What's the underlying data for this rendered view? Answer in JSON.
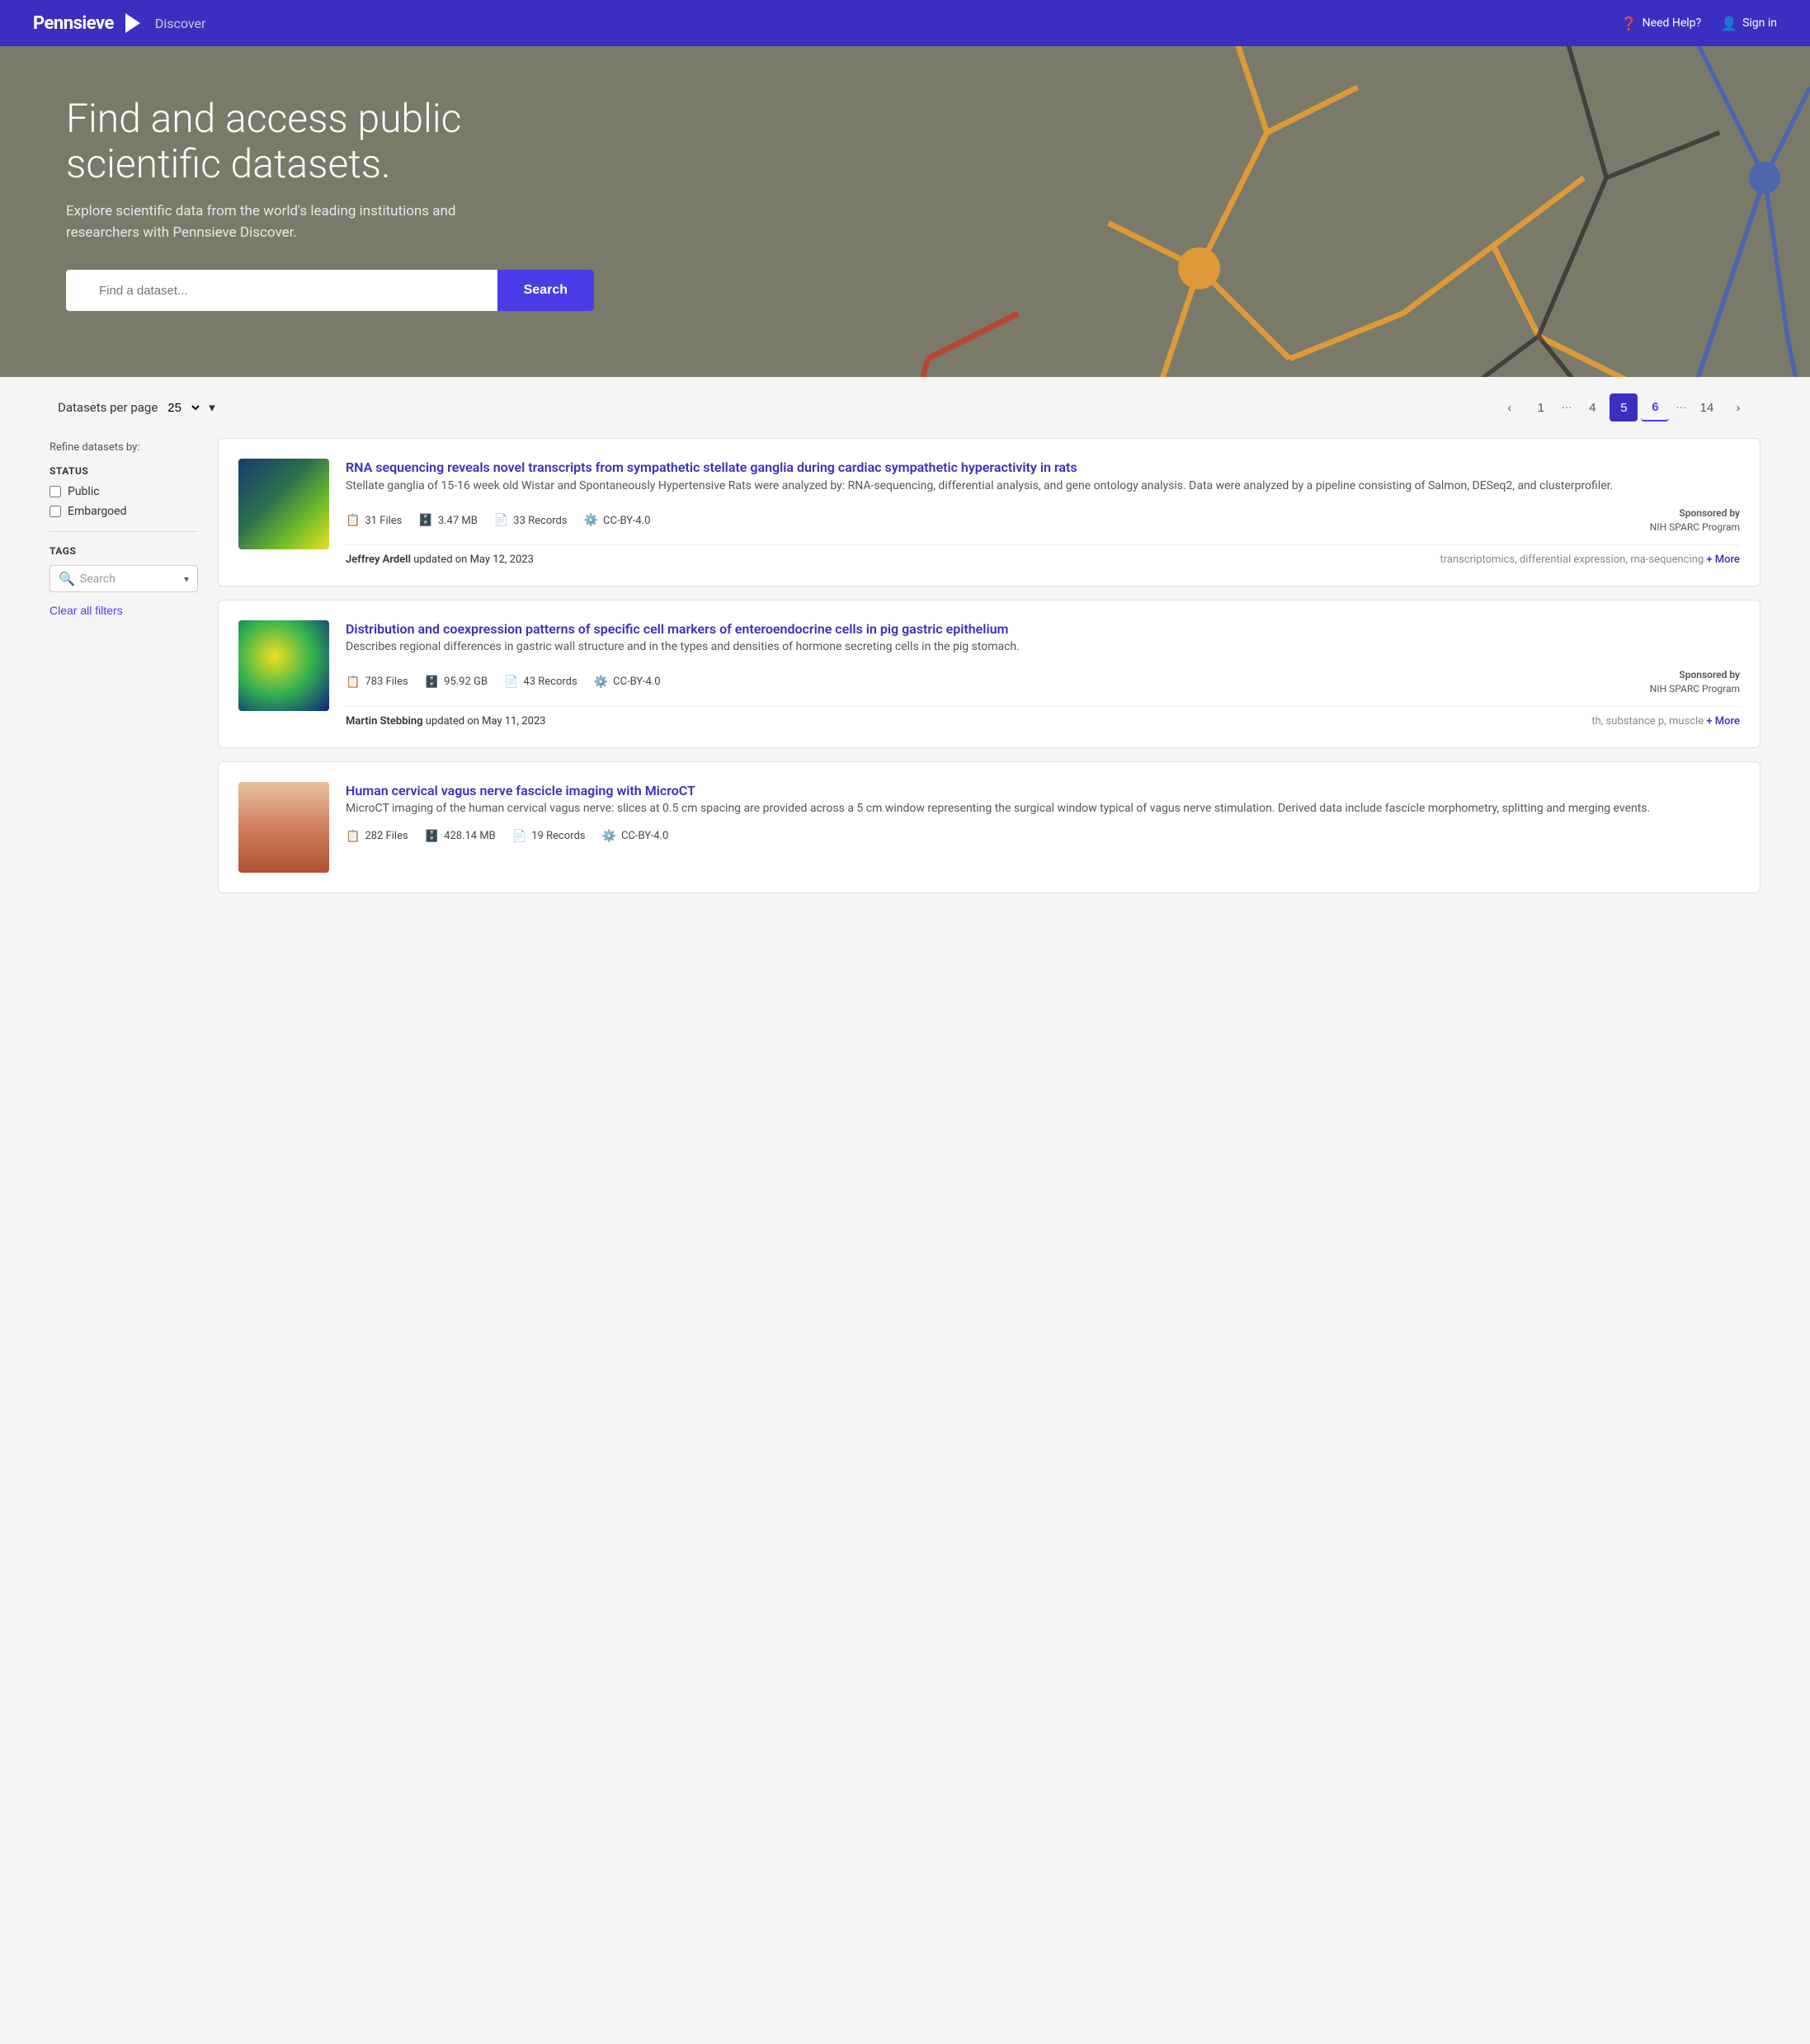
{
  "header": {
    "logo": "Pennsieve",
    "section": "Discover",
    "nav": {
      "help": "Need Help?",
      "signin": "Sign in"
    }
  },
  "hero": {
    "title": "Find and access public scientific datasets.",
    "subtitle": "Explore scientific data from the world's leading institutions and researchers with Pennsieve Discover.",
    "search_placeholder": "Find a dataset...",
    "search_button": "Search"
  },
  "pagination": {
    "per_page_label": "Datasets per page",
    "per_page_value": "25",
    "pages": [
      "1",
      "...",
      "4",
      "5",
      "6",
      "...",
      "14"
    ],
    "current_page": "5",
    "prev_icon": "‹",
    "next_icon": "›"
  },
  "sidebar": {
    "refine_label": "Refine datasets by:",
    "status_label": "STATUS",
    "status_options": [
      "Public",
      "Embargoed"
    ],
    "tags_label": "TAGS",
    "tags_search_placeholder": "Search",
    "clear_label": "Clear all filters"
  },
  "datasets": [
    {
      "id": 1,
      "title": "RNA sequencing reveals novel transcripts from sympathetic stellate ganglia during cardiac sympathetic hyperactivity in rats",
      "description": "Stellate ganglia of 15-16 week old Wistar and Spontaneously Hypertensive Rats were analyzed by: RNA-sequencing, differential analysis, and gene ontology analysis. Data were analyzed by a pipeline consisting of Salmon, DESeq2, and clusterprofiler.",
      "files": "31 Files",
      "size": "3.47 MB",
      "records": "33 Records",
      "license": "CC-BY-4.0",
      "sponsored_by": "Sponsored by",
      "sponsor": "NIH SPARC Program",
      "author": "Jeffrey Ardell",
      "updated": "updated on May 12, 2023",
      "tags": "transcriptomics, differential expression, rna-sequencing",
      "more": "+ More",
      "thumb_class": "thumb-1"
    },
    {
      "id": 2,
      "title": "Distribution and coexpression patterns of specific cell markers of enteroendocrine cells in pig gastric epithelium",
      "description": "Describes regional differences in gastric wall structure and in the types and densities of hormone secreting cells in the pig stomach.",
      "files": "783 Files",
      "size": "95.92 GB",
      "records": "43 Records",
      "license": "CC-BY-4.0",
      "sponsored_by": "Sponsored by",
      "sponsor": "NIH SPARC Program",
      "author": "Martin Stebbing",
      "updated": "updated on May 11, 2023",
      "tags": "th, substance p, muscle",
      "more": "+ More",
      "thumb_class": "thumb-2"
    },
    {
      "id": 3,
      "title": "Human cervical vagus nerve fascicle imaging with MicroCT",
      "description": "MicroCT imaging of the human cervical vagus nerve: slices at 0.5 cm spacing are provided across a 5 cm window representing the surgical window typical of vagus nerve stimulation. Derived data include fascicle morphometry, splitting and merging events.",
      "files": "282 Files",
      "size": "428.14 MB",
      "records": "19 Records",
      "license": "CC-BY-4.0",
      "sponsored_by": "",
      "sponsor": "",
      "author": "",
      "updated": "",
      "tags": "",
      "more": "",
      "thumb_class": "thumb-3"
    }
  ]
}
